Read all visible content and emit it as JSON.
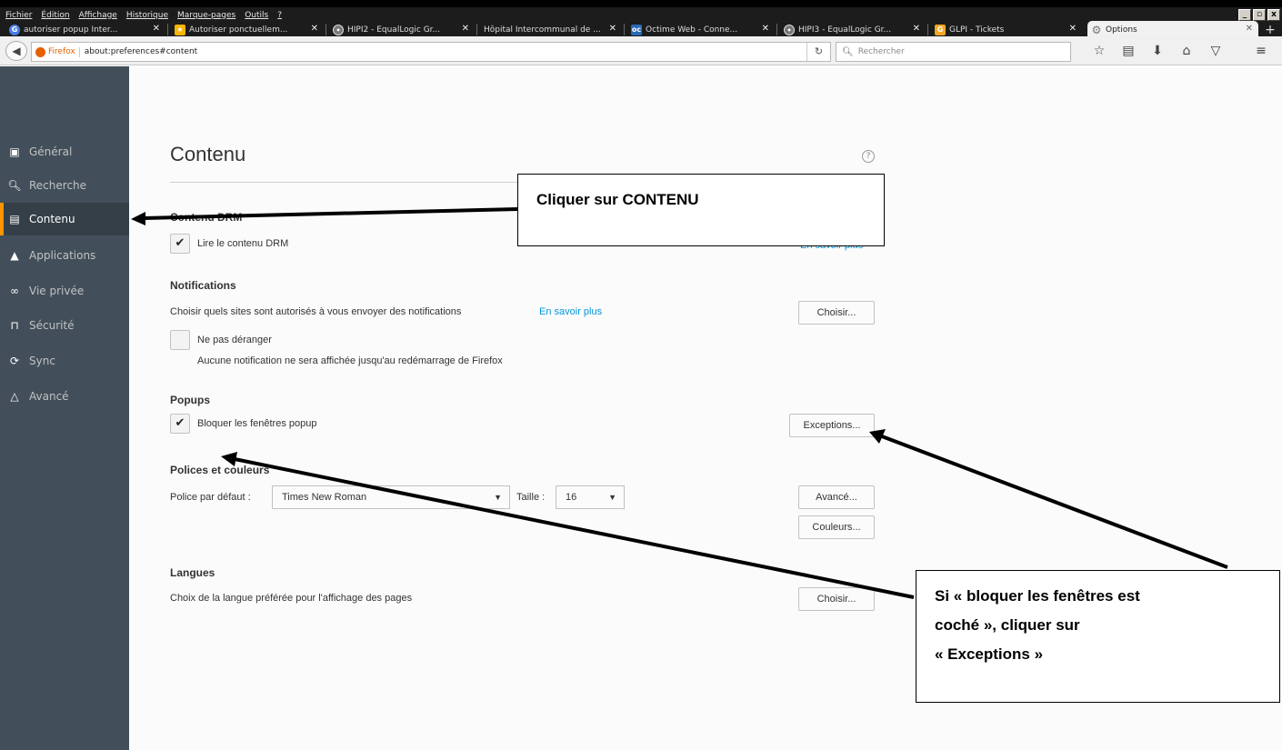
{
  "menu": [
    "Fichier",
    "Édition",
    "Affichage",
    "Historique",
    "Marque-pages",
    "Outils",
    "?"
  ],
  "window_controls": [
    "_",
    "▫",
    "x"
  ],
  "tabs": [
    {
      "title": "autoriser popup Inter...",
      "icon": "google-icon",
      "color": "#4a7be0"
    },
    {
      "title": "Autoriser ponctuellem...",
      "icon": "bookmark-icon",
      "color": "#f5b400"
    },
    {
      "title": "HIPI2 - EqualLogic Gr...",
      "icon": "dell-icon",
      "color": "#777"
    },
    {
      "title": "Hôpital Intercommunal de ...",
      "icon": "",
      "color": ""
    },
    {
      "title": "Octime Web - Conne...",
      "icon": "octime-icon",
      "color": "#2a6ab5"
    },
    {
      "title": "HIPI3 - EqualLogic Gr...",
      "icon": "dell-icon",
      "color": "#777"
    },
    {
      "title": "GLPI - Tickets",
      "icon": "glpi-icon",
      "color": "#f5a623"
    },
    {
      "title": "Options",
      "icon": "gear-icon",
      "color": "#888"
    }
  ],
  "url": {
    "identity": "Firefox",
    "address": "about:preferences#content"
  },
  "search_placeholder": "Rechercher",
  "sidebar": [
    {
      "label": "Général",
      "icon": "general-icon"
    },
    {
      "label": "Recherche",
      "icon": "search-icon"
    },
    {
      "label": "Contenu",
      "icon": "document-icon",
      "active": true
    },
    {
      "label": "Applications",
      "icon": "rocket-icon"
    },
    {
      "label": "Vie privée",
      "icon": "mask-icon"
    },
    {
      "label": "Sécurité",
      "icon": "lock-icon"
    },
    {
      "label": "Sync",
      "icon": "sync-icon"
    },
    {
      "label": "Avancé",
      "icon": "wizard-hat-icon"
    }
  ],
  "content": {
    "title": "Contenu",
    "drm": {
      "title": "Contenu DRM",
      "checkbox_label": "Lire le contenu DRM",
      "checked": true,
      "link": "En savoir plus"
    },
    "notifications": {
      "title": "Notifications",
      "description": "Choisir quels sites sont autorisés à vous envoyer des notifications",
      "link": "En savoir plus",
      "button": "Choisir...",
      "dnd_label": "Ne pas déranger",
      "dnd_checked": false,
      "dnd_desc": "Aucune notification ne sera affichée jusqu'au redémarrage de Firefox"
    },
    "popups": {
      "title": "Popups",
      "checkbox_label": "Bloquer les fenêtres popup",
      "checked": true,
      "button": "Exceptions..."
    },
    "fonts": {
      "title": "Polices et couleurs",
      "default_font_label": "Police par défaut :",
      "default_font": "Times New Roman",
      "size_label": "Taille :",
      "size": "16",
      "advanced_button": "Avancé...",
      "colors_button": "Couleurs..."
    },
    "languages": {
      "title": "Langues",
      "description": "Choix de la langue préférée pour l'affichage des pages",
      "button": "Choisir..."
    }
  },
  "callouts": {
    "contenu": "Cliquer sur CONTENU",
    "popup_line1": "Si « bloquer les fenêtres est",
    "popup_line2": "coché », cliquer sur",
    "popup_line3": "« Exceptions »"
  },
  "colors": {
    "sidebar_bg": "#424f5a",
    "active_accent": "#ff9500",
    "link": "#0096dd"
  }
}
